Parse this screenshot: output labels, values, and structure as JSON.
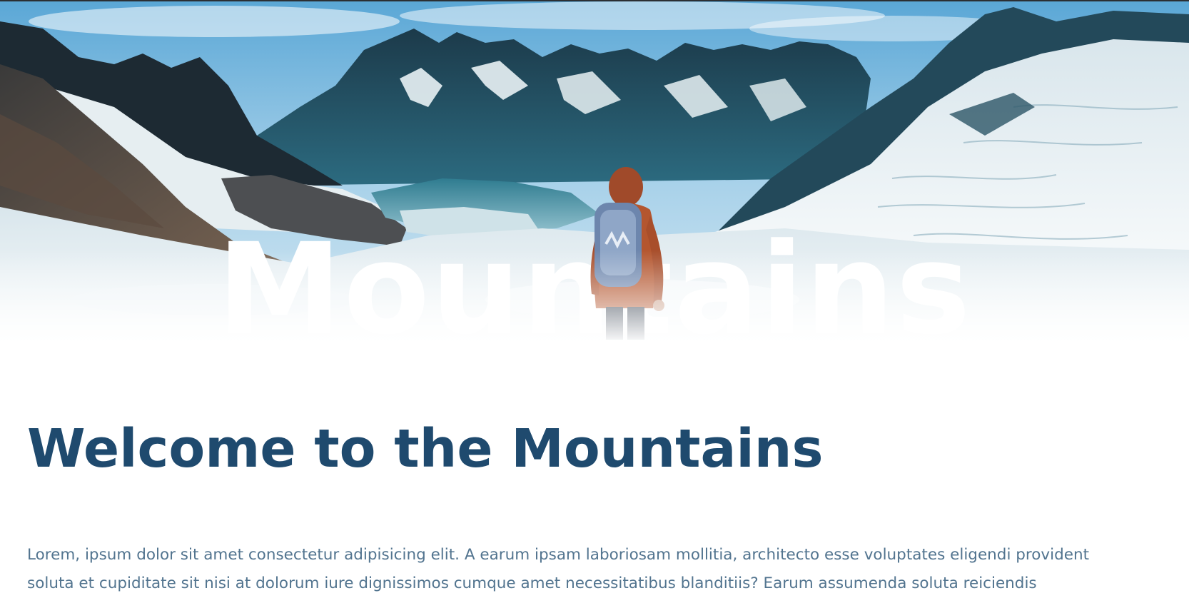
{
  "hero": {
    "title": "Mountains",
    "image_alt": "hiker-overlooking-glacier-mountains"
  },
  "welcome": {
    "title": "Welcome to the Mountains",
    "paragraph_lines": [
      "Lorem, ipsum dolor sit amet consectetur adipisicing elit. A earum ipsam laboriosam mollitia, architecto esse voluptates eligendi provident",
      "soluta et cupiditate sit nisi at dolorum iure dignissimos cumque amet necessitatibus blanditiis? Earum assumenda soluta reiciendis"
    ]
  },
  "colors": {
    "title": "#1f4a6e",
    "body_text": "#52748f",
    "hero_title": "#ffffff"
  }
}
